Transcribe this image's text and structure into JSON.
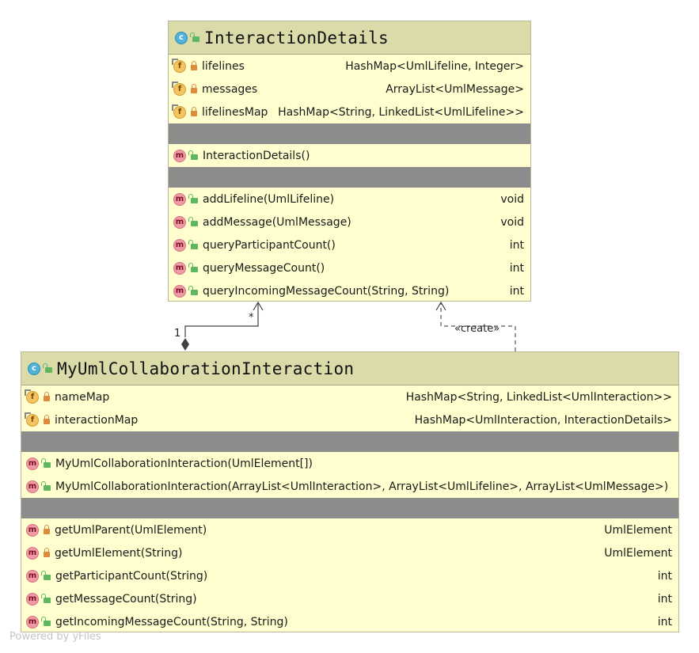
{
  "interaction_details": {
    "title": "InteractionDetails",
    "fields": [
      {
        "name": "lifelines",
        "type": "HashMap<UmlLifeline, Integer>",
        "visibility": "private"
      },
      {
        "name": "messages",
        "type": "ArrayList<UmlMessage>",
        "visibility": "private"
      },
      {
        "name": "lifelinesMap",
        "type": "HashMap<String, LinkedList<UmlLifeline>>",
        "visibility": "private"
      }
    ],
    "constructors": [
      {
        "name": "InteractionDetails()",
        "type": "",
        "visibility": "public"
      }
    ],
    "methods": [
      {
        "name": "addLifeline(UmlLifeline)",
        "type": "void",
        "visibility": "public"
      },
      {
        "name": "addMessage(UmlMessage)",
        "type": "void",
        "visibility": "public"
      },
      {
        "name": "queryParticipantCount()",
        "type": "int",
        "visibility": "public"
      },
      {
        "name": "queryMessageCount()",
        "type": "int",
        "visibility": "public"
      },
      {
        "name": "queryIncomingMessageCount(String, String)",
        "type": "int",
        "visibility": "public"
      }
    ]
  },
  "my_uml_collaboration_interaction": {
    "title": "MyUmlCollaborationInteraction",
    "fields": [
      {
        "name": "nameMap",
        "type": "HashMap<String, LinkedList<UmlInteraction>>",
        "visibility": "private"
      },
      {
        "name": "interactionMap",
        "type": "HashMap<UmlInteraction, InteractionDetails>",
        "visibility": "private"
      }
    ],
    "constructors": [
      {
        "name": "MyUmlCollaborationInteraction(UmlElement[])",
        "type": "",
        "visibility": "public"
      },
      {
        "name": "MyUmlCollaborationInteraction(ArrayList<UmlInteraction>, ArrayList<UmlLifeline>, ArrayList<UmlMessage>)",
        "type": "",
        "visibility": "public"
      }
    ],
    "methods": [
      {
        "name": "getUmlParent(UmlElement)",
        "type": "UmlElement",
        "visibility": "private"
      },
      {
        "name": "getUmlElement(String)",
        "type": "UmlElement",
        "visibility": "private"
      },
      {
        "name": "getParticipantCount(String)",
        "type": "int",
        "visibility": "public"
      },
      {
        "name": "getMessageCount(String)",
        "type": "int",
        "visibility": "public"
      },
      {
        "name": "getIncomingMessageCount(String, String)",
        "type": "int",
        "visibility": "public"
      }
    ]
  },
  "relations": {
    "composition_source_multiplicity": "1",
    "composition_target_multiplicity": "*",
    "dependency_label": "«create»"
  },
  "icons": {
    "class": "c",
    "field": "f",
    "method": "m"
  },
  "colors": {
    "class_fill": "#fefecf",
    "header_fill": "#dbdbaa",
    "separator": "#8c8c8c",
    "private": "#e08a3c",
    "public": "#5fb85f"
  },
  "footer": "Powered by yFiles"
}
